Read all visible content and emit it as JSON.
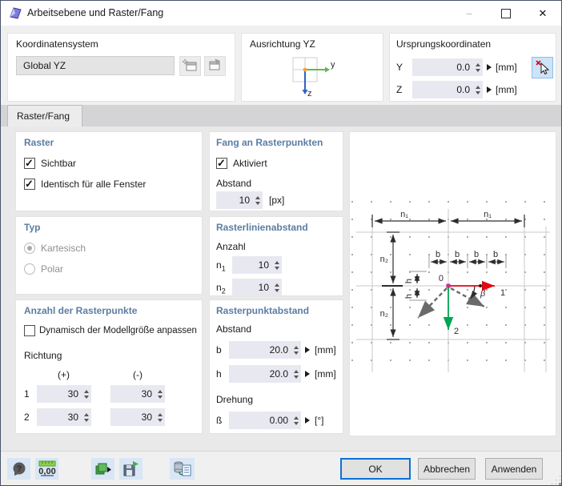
{
  "window": {
    "title": "Arbeitsebene und Raster/Fang",
    "minimize_glyph": "–",
    "close_glyph": "✕"
  },
  "coordinate_system": {
    "header": "Koordinatensystem",
    "value": "Global YZ"
  },
  "orientation": {
    "header": "Ausrichtung YZ",
    "axis_y": "y",
    "axis_z": "z"
  },
  "origin": {
    "header": "Ursprungskoordinaten",
    "rows": [
      {
        "label": "Y",
        "value": "0.0",
        "unit": "[mm]"
      },
      {
        "label": "Z",
        "value": "0.0",
        "unit": "[mm]"
      }
    ]
  },
  "tabs": {
    "active": "Raster/Fang"
  },
  "raster": {
    "header": "Raster",
    "visible_label": "Sichtbar",
    "visible_checked": "true",
    "identical_label": "Identisch für alle Fenster",
    "identical_checked": "true"
  },
  "snap": {
    "header": "Fang an Rasterpunkten",
    "active_label": "Aktiviert",
    "active_checked": "true",
    "distance_label": "Abstand",
    "distance_value": "10",
    "distance_unit": "[px]"
  },
  "typ": {
    "header": "Typ",
    "cartesian_label": "Kartesisch",
    "cartesian_selected": "true",
    "polar_label": "Polar",
    "polar_selected": "false"
  },
  "grid_lines": {
    "header": "Rasterlinienabstand",
    "count_label": "Anzahl",
    "rows": [
      {
        "base": "n",
        "sub": "1",
        "value": "10"
      },
      {
        "base": "n",
        "sub": "2",
        "value": "10"
      }
    ]
  },
  "point_count": {
    "header": "Anzahl der Rasterpunkte",
    "dynamic_label": "Dynamisch der Modellgröße anpassen",
    "dynamic_checked": "false",
    "direction_label": "Richtung",
    "plus_header": "(+)",
    "minus_header": "(-)",
    "rows": [
      {
        "label": "1",
        "plus": "30",
        "minus": "30"
      },
      {
        "label": "2",
        "plus": "30",
        "minus": "30"
      }
    ]
  },
  "point_spacing": {
    "header": "Rasterpunktabstand",
    "distance_label": "Abstand",
    "rows": [
      {
        "label": "b",
        "value": "20.0",
        "unit": "[mm]"
      },
      {
        "label": "h",
        "value": "20.0",
        "unit": "[mm]"
      }
    ],
    "rotation_label": "Drehung",
    "rotation": {
      "label": "ß",
      "value": "0.00",
      "unit": "[°]"
    }
  },
  "diagram": {
    "n1": "n₁",
    "n2": "n₂",
    "b": "b",
    "h": "h",
    "origin_label": "0",
    "axis1_label": "1",
    "axis2_label": "2",
    "beta_label": "β"
  },
  "footer": {
    "units_text": "0,00",
    "ok": "OK",
    "cancel": "Abbrechen",
    "apply": "Anwenden"
  },
  "colors": {
    "accent_blue": "#0b71d6",
    "header_blue": "#5b7da3",
    "axis1_red": "#e30613",
    "axis2_green": "#00a651",
    "origin_magenta": "#cc2990"
  }
}
